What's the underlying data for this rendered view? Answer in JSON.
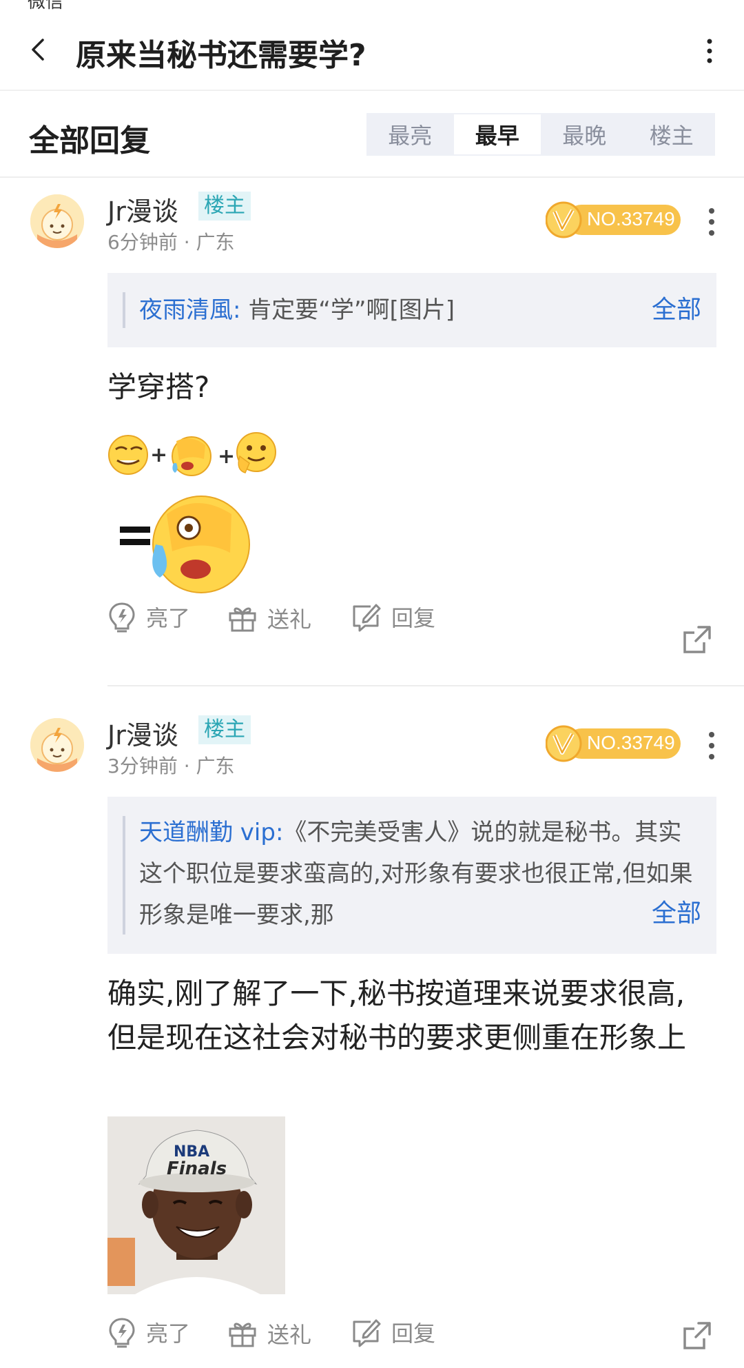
{
  "top_stub": "微信",
  "header": {
    "title": "原来当秘书还需要学?"
  },
  "section": {
    "title": "全部回复",
    "tabs": [
      {
        "label": "最亮",
        "active": false
      },
      {
        "label": "最早",
        "active": true
      },
      {
        "label": "最晚",
        "active": false
      },
      {
        "label": "楼主",
        "active": false
      }
    ]
  },
  "level_badge": "NO.33749",
  "actions": {
    "light": "亮了",
    "gift": "送礼",
    "reply": "回复"
  },
  "posts": [
    {
      "author": "Jr漫谈",
      "op_badge": "楼主",
      "time": "6分钟前",
      "location": "广东",
      "quote": {
        "author": "夜雨清風:",
        "text": "肯定要“学”啊[图片]",
        "all_label": "全部"
      },
      "text": "学穿搭?",
      "image": "emoji-combo"
    },
    {
      "author": "Jr漫谈",
      "op_badge": "楼主",
      "time": "3分钟前",
      "location": "广东",
      "quote": {
        "author": "天道酬勤 vip:",
        "text": "《不完美受害人》说的就是秘书。其实这个职位是要求蛮高的,对形象有要求也很正常,但如果形象是唯一要求,那",
        "all_label": "全部"
      },
      "text": "确实,刚了解了一下,秘书按道理来说要求很高,但是现在这社会对秘书的要求更侧重在形象上",
      "image": "reaction-photo"
    }
  ]
}
